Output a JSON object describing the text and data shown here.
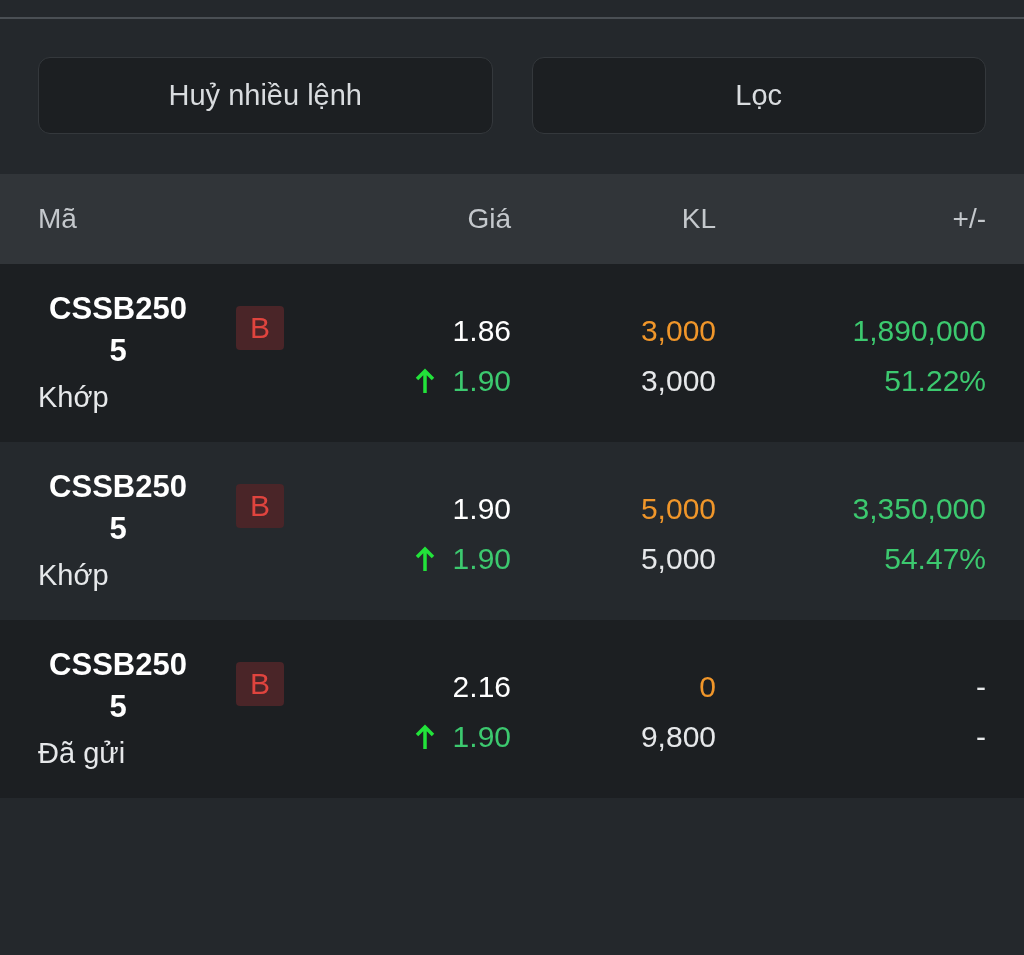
{
  "actions": [
    {
      "label": "Huỷ nhiều lệnh"
    },
    {
      "label": "Lọc"
    }
  ],
  "columns": [
    "Mã",
    "Giá",
    "KL",
    "+/-"
  ],
  "orders": [
    {
      "symbol": "CSSB2505",
      "side": "B",
      "status": "Khớp",
      "price": "1.86",
      "kind": "up",
      "match_price": "1.90",
      "qty": "3,000",
      "matched_qty": "3,000",
      "value": "1,890,000",
      "percent": "51.22%"
    },
    {
      "symbol": "CSSB2505",
      "side": "B",
      "status": "Khớp",
      "price": "1.90",
      "kind": "up",
      "match_price": "1.90",
      "qty": "5,000",
      "matched_qty": "5,000",
      "value": "3,350,000",
      "percent": "54.47%"
    },
    {
      "symbol": "CSSB2505",
      "side": "B",
      "status": "Đã gửi",
      "price": "2.16",
      "kind": "up",
      "match_price": "1.90",
      "qty": "0",
      "matched_qty": "9,800",
      "value": "-",
      "percent": "-"
    }
  ]
}
